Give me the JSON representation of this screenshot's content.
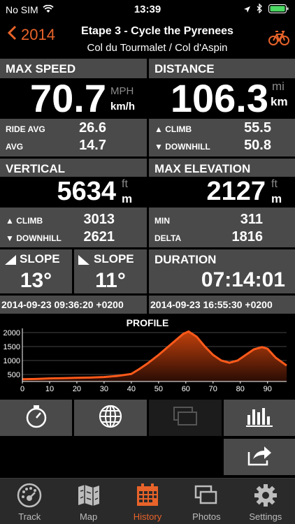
{
  "status": {
    "carrier": "No SIM",
    "time": "13:39"
  },
  "header": {
    "back_label": "2014",
    "title": "Etape 3 - Cycle the Pyrenees",
    "subtitle": "Col du Tourmalet / Col d'Aspin"
  },
  "max_speed": {
    "label": "MAX SPEED",
    "value": "70.7",
    "unit_alt": "MPH",
    "unit": "km/h",
    "ride_avg_label": "RIDE AVG",
    "ride_avg": "26.6",
    "avg_label": "AVG",
    "avg": "14.7"
  },
  "distance": {
    "label": "DISTANCE",
    "value": "106.3",
    "unit_alt": "mi",
    "unit": "km",
    "climb_label": "▲ CLIMB",
    "climb": "55.5",
    "downhill_label": "▼ DOWNHILL",
    "downhill": "50.8"
  },
  "vertical": {
    "label": "VERTICAL",
    "value": "5634",
    "unit_alt": "ft",
    "unit": "m",
    "climb_label": "▲ CLIMB",
    "climb": "3013",
    "downhill_label": "▼ DOWNHILL",
    "downhill": "2621"
  },
  "max_elevation": {
    "label": "MAX ELEVATION",
    "value": "2127",
    "unit_alt": "ft",
    "unit": "m",
    "min_label": "MIN",
    "min": "311",
    "delta_label": "DELTA",
    "delta": "1816"
  },
  "slope_up": {
    "label": "SLOPE",
    "value": "13°"
  },
  "slope_down": {
    "label": "SLOPE",
    "value": "11°"
  },
  "duration": {
    "label": "DURATION",
    "value": "07:14:01"
  },
  "timestamps": {
    "start": "2014-09-23 09:36:20 +0200",
    "end": "2014-09-23 16:55:30 +0200"
  },
  "chart_data": {
    "type": "area",
    "title": "PROFILE",
    "xlim": [
      0,
      97
    ],
    "ylim": [
      250,
      2150
    ],
    "x_ticks": [
      0,
      10,
      20,
      30,
      40,
      50,
      60,
      70,
      80,
      90
    ],
    "y_ticks": [
      500,
      1000,
      1500,
      2000
    ],
    "x": [
      0,
      5,
      10,
      15,
      20,
      25,
      30,
      35,
      40,
      43,
      46,
      50,
      53,
      56,
      59,
      61,
      64,
      67,
      70,
      73,
      76,
      79,
      82,
      85,
      88,
      90,
      93,
      97
    ],
    "y": [
      330,
      340,
      360,
      370,
      380,
      390,
      410,
      450,
      520,
      700,
      900,
      1200,
      1450,
      1700,
      1950,
      2040,
      1850,
      1500,
      1200,
      1000,
      920,
      1000,
      1200,
      1400,
      1480,
      1420,
      1100,
      820
    ],
    "colors": {
      "line": "#ff5a1a",
      "fill_top": "#c2410c",
      "fill_bottom": "#2a0c04"
    }
  },
  "tabs": [
    {
      "label": "Track",
      "icon": "dial-icon"
    },
    {
      "label": "Map",
      "icon": "map-icon"
    },
    {
      "label": "History",
      "icon": "calendar-icon"
    },
    {
      "label": "Photos",
      "icon": "photos-icon"
    },
    {
      "label": "Settings",
      "icon": "gear-icon"
    }
  ],
  "accent": "#e8632a"
}
